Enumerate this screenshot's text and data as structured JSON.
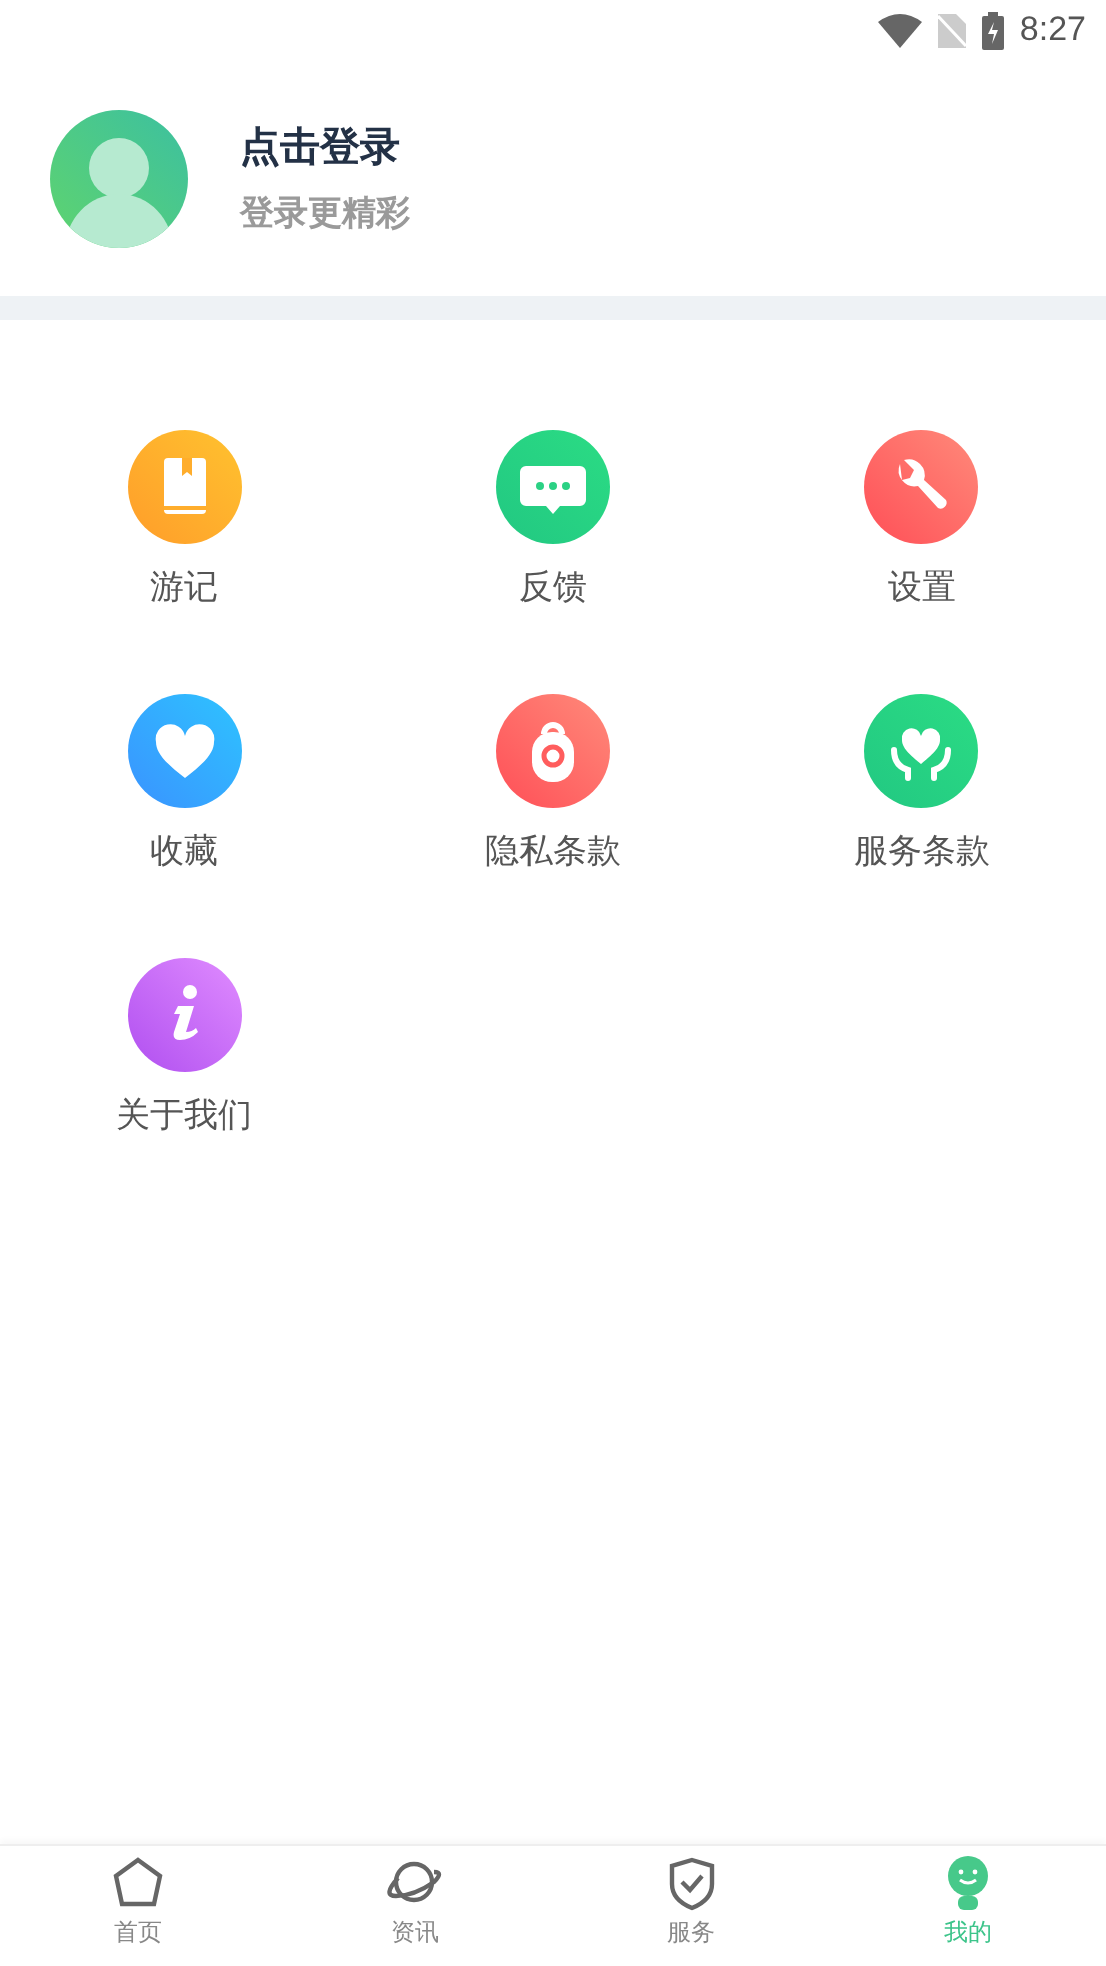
{
  "status_bar": {
    "time": "8:27"
  },
  "profile": {
    "title": "点击登录",
    "subtitle": "登录更精彩"
  },
  "menu": [
    {
      "kind": "book",
      "label": "游记"
    },
    {
      "kind": "chat",
      "label": "反馈"
    },
    {
      "kind": "wrench",
      "label": "设置"
    },
    {
      "kind": "heart",
      "label": "收藏"
    },
    {
      "kind": "lock",
      "label": "隐私条款"
    },
    {
      "kind": "hands",
      "label": "服务条款"
    },
    {
      "kind": "info",
      "label": "关于我们"
    }
  ],
  "tab_bar": [
    {
      "kind": "home",
      "label": "首页",
      "selected": false
    },
    {
      "kind": "planet",
      "label": "资讯",
      "selected": false
    },
    {
      "kind": "shield",
      "label": "服务",
      "selected": false
    },
    {
      "kind": "smile",
      "label": "我的",
      "selected": true
    }
  ]
}
